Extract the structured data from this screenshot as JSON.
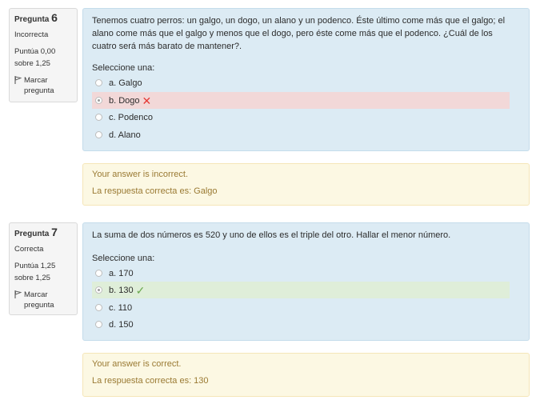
{
  "questions": [
    {
      "label": "Pregunta",
      "number": "6",
      "state": "Incorrecta",
      "grade": "Puntúa 0,00 sobre 1,25",
      "flag_label": "Marcar pregunta",
      "text": "Tenemos cuatro perros: un galgo, un dogo, un alano y un podenco. Éste último come más que el galgo; el alano come más que el galgo y menos que el dogo, pero éste come más que el podenco. ¿Cuál de los cuatro será más barato de mantener?.",
      "prompt": "Seleccione una:",
      "options": [
        "a. Galgo",
        "b. Dogo",
        "c. Podenco",
        "d. Alano"
      ],
      "selected_option": "b. Dogo",
      "feedback": "Your answer is incorrect.",
      "right_answer": "La respuesta correcta es: Galgo"
    },
    {
      "label": "Pregunta",
      "number": "7",
      "state": "Correcta",
      "grade": "Puntúa 1,25 sobre 1,25",
      "flag_label": "Marcar pregunta",
      "text": "La suma de dos números es 520 y uno de ellos es el triple del otro. Hallar el menor número.",
      "prompt": "Seleccione una:",
      "options": [
        "a. 170",
        "b. 130",
        "c. 110",
        "d. 150"
      ],
      "selected_option": "b. 130",
      "feedback": "Your answer is correct.",
      "right_answer": "La respuesta correcta es: 130"
    }
  ],
  "icons": {
    "flag": "flag-icon",
    "incorrect": "cross-icon",
    "correct": "check-icon"
  },
  "colors": {
    "question_bg": "#dcebf4",
    "incorrect_bg": "#f2d8d8",
    "correct_bg": "#dfeed9",
    "outcome_bg": "#fcf8e3",
    "outcome_text": "#9a7a33",
    "cross": "#e53935",
    "check": "#6aa84f"
  }
}
